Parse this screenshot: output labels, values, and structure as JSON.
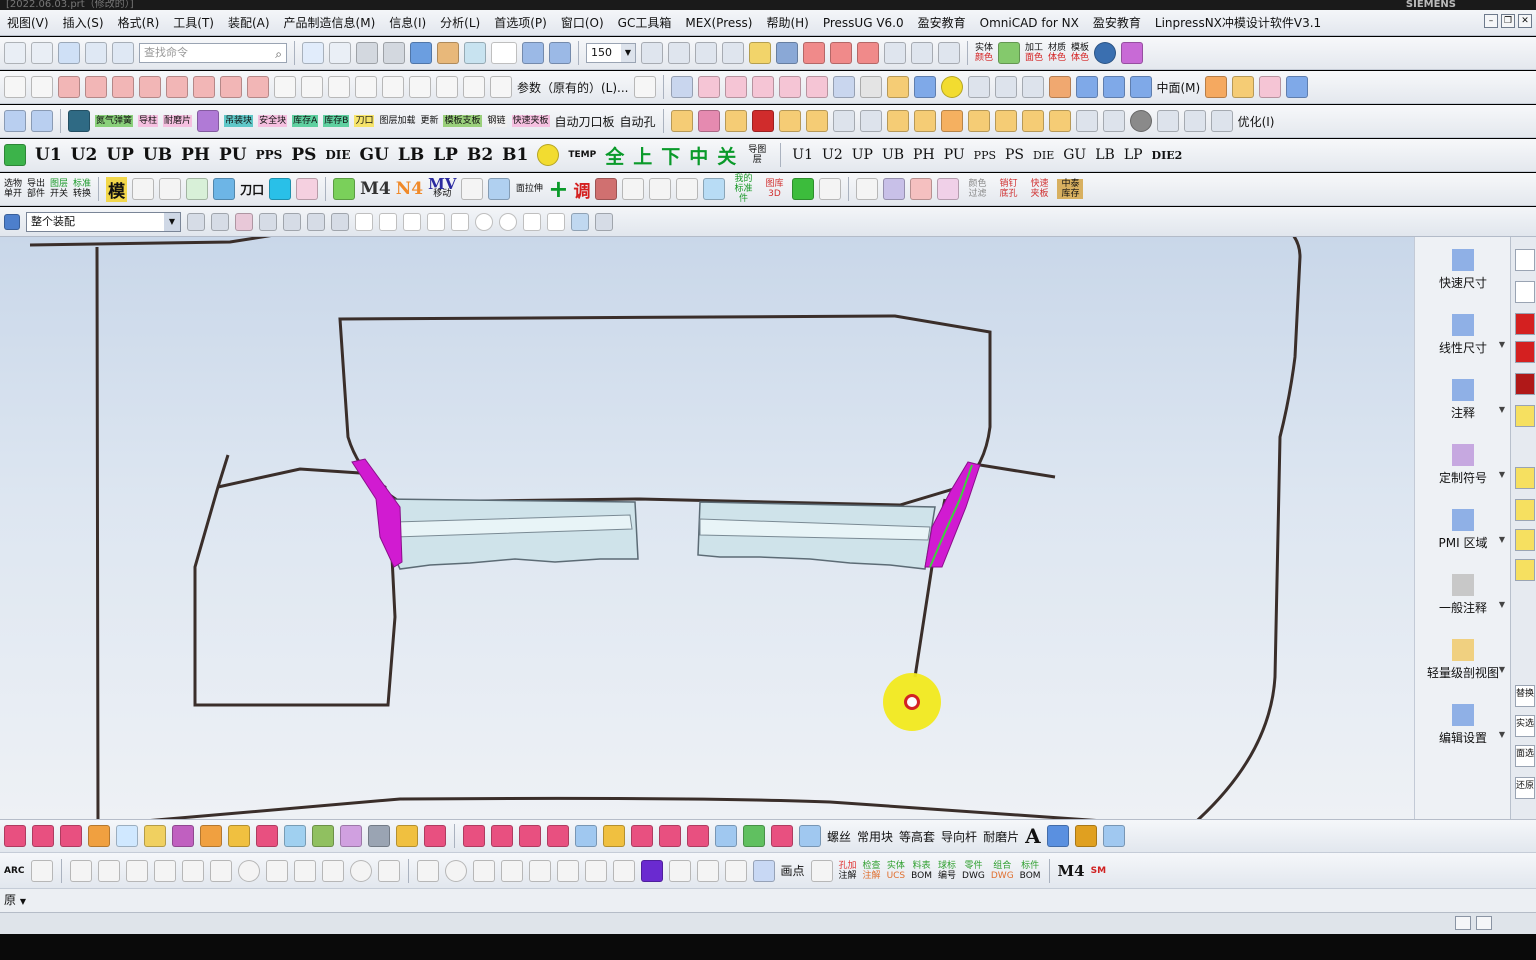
{
  "window": {
    "title": "[2022.06.03.prt（修改的）]",
    "brand": "SIEMENS"
  },
  "menu": [
    "视图(V)",
    "插入(S)",
    "格式(R)",
    "工具(T)",
    "装配(A)",
    "产品制造信息(M)",
    "信息(I)",
    "分析(L)",
    "首选项(P)",
    "窗口(O)",
    "GC工具箱",
    "MEX(Press)",
    "帮助(H)",
    "PressUG V6.0",
    "盈安教育",
    "OmniCAD for NX",
    "盈安教育",
    "LinpressNX冲模设计软件V3.1"
  ],
  "toolbar1": {
    "search_placeholder": "查找命令",
    "zoom_value": "150",
    "tool_labels": [
      [
        "实体",
        "颜色"
      ],
      [
        "加工",
        "面色"
      ],
      [
        "材质",
        "体色"
      ],
      [
        "模板",
        "体色"
      ]
    ]
  },
  "toolbar2": {
    "param_label": "参数（原有的）(L)...",
    "midface_label": "中面(M)"
  },
  "toolbar3": {
    "labels": [
      "氮气弹簧",
      "导柱",
      "耐磨片",
      "吊装块",
      "安全块",
      "库存A",
      "库存B",
      "刀口",
      "图层加载",
      "更新",
      "模板支板",
      "钢链",
      "快速夹板"
    ],
    "auto_knife_label": "自动刀口板",
    "auto_hole_label": "自动孔",
    "optimize_label": "优化(I)"
  },
  "toolbar4": {
    "items": [
      "U1",
      "U2",
      "UP",
      "UB",
      "PH",
      "PU",
      "PPS",
      "PS",
      "DIE",
      "GU",
      "LB",
      "LP",
      "B2",
      "B1"
    ],
    "temp_label": "TEMP",
    "chinese_big": [
      "全",
      "上",
      "下",
      "中",
      "关"
    ],
    "nav_label": "导图层",
    "move_items": [
      "U1",
      "U2",
      "UP",
      "UB",
      "PH",
      "PU",
      "PPS",
      "PS",
      "DIE",
      "GU",
      "LB",
      "LP"
    ],
    "die2_label": "DIE2"
  },
  "toolbar5": {
    "labels": [
      [
        "选物",
        "单开"
      ],
      [
        "导出",
        "部件"
      ],
      [
        "图层",
        "开关"
      ],
      [
        "标准",
        "转换"
      ]
    ],
    "mold_char": "模",
    "knife_label": "刀口",
    "m4": "M4",
    "n4": "N4",
    "mv": "MV",
    "mv_sub": "移动",
    "face_label": "面拉伸",
    "adjust_char": "调",
    "my_std": "我的标准件",
    "lib_3d": "图库3D",
    "color_filter": "颜色过滤",
    "nail_label": "销钉底孔",
    "quick_clip": "快速夹板",
    "mid_store": "中泰库存"
  },
  "selection_bar": {
    "filter_value": "整个装配"
  },
  "right_panel": {
    "items": [
      "快速尺寸",
      "线性尺寸",
      "注释",
      "定制符号",
      "PMI 区域",
      "一般注释",
      "轻量级剖视图",
      "编辑设置"
    ]
  },
  "far_right": {
    "items": [
      "替换",
      "实选",
      "面选",
      "还原"
    ]
  },
  "bottom_toolbar1": {
    "labels": [
      "螺丝",
      "常用块",
      "等高套",
      "导向杆",
      "耐磨片"
    ]
  },
  "bottom_toolbar2": {
    "arc_label": "ARC",
    "draw_point": "画点",
    "labels": [
      [
        "孔加",
        "注解"
      ],
      [
        "检查",
        "注解"
      ],
      [
        "实体",
        "UCS"
      ],
      [
        "料表",
        "BOM"
      ],
      [
        "球标",
        "编号"
      ],
      [
        "零件",
        "DWG"
      ],
      [
        "组合",
        "DWG"
      ],
      [
        "标件",
        "BOM"
      ]
    ],
    "m4": "M4",
    "sm": "SM"
  },
  "bottom_bar3": {
    "label": "原"
  }
}
